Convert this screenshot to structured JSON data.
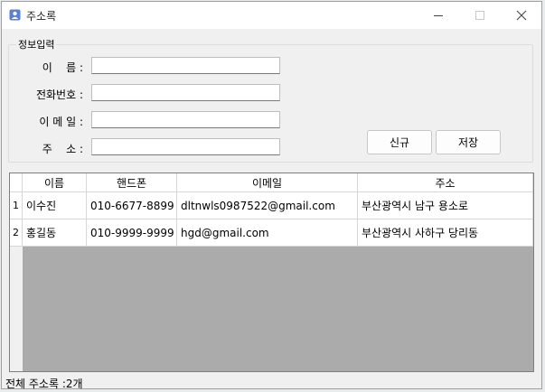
{
  "window": {
    "title": "주소록",
    "icon": "address-book-icon"
  },
  "form": {
    "group_title": "정보입력",
    "fields": [
      {
        "label": "이    름 :",
        "value": ""
      },
      {
        "label": "전화번호 :",
        "value": ""
      },
      {
        "label": "이 메 일 :",
        "value": ""
      },
      {
        "label": "주    소 :",
        "value": ""
      }
    ],
    "new_button": "신규",
    "save_button": "저장"
  },
  "table": {
    "columns": [
      "이름",
      "핸드폰",
      "이메일",
      "주소"
    ],
    "rows": [
      {
        "num": "1",
        "cells": [
          "이수진",
          "010-6677-8899",
          "dltnwls0987522@gmail.com",
          "부산광역시 남구 용소로"
        ]
      },
      {
        "num": "2",
        "cells": [
          "홍길동",
          "010-9999-9999",
          "hgd@gmail.com",
          "부산광역시 사하구 당리동"
        ]
      }
    ]
  },
  "status": {
    "text": "전체 주소록 :2개"
  }
}
